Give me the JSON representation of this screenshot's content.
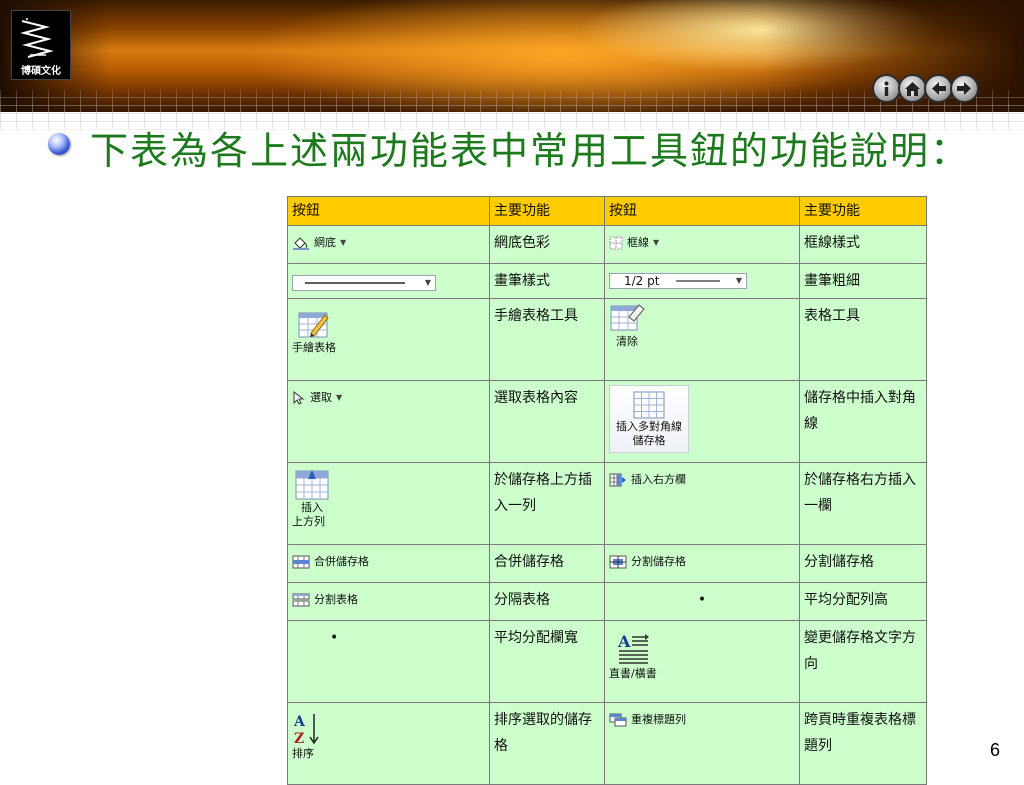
{
  "logo": {
    "text": "博碩文化"
  },
  "nav": [
    "info",
    "home",
    "back",
    "forward"
  ],
  "heading": {
    "text": "下表為各上述兩功能表中常用工具鈕的功能說明："
  },
  "table": {
    "headers": [
      "按鈕",
      "主要功能",
      "按鈕",
      "主要功能"
    ],
    "rows": [
      {
        "b1": "網底",
        "f1": "網底色彩",
        "b2": "框線",
        "f2": "框線樣式"
      },
      {
        "b1": "",
        "f1": "畫筆樣式",
        "b2": "1/2 pt",
        "f2": "畫筆粗細"
      },
      {
        "b1": "手繪表格",
        "f1": "手繪表格工具",
        "b2": "清除",
        "f2": "表格工具"
      },
      {
        "b1": "選取",
        "f1": "選取表格內容",
        "b2": "插入多對角線儲存格",
        "f2": "儲存格中插入對角線"
      },
      {
        "b1": "插入上方列",
        "f1": "於儲存格上方插入一列",
        "b2": "插入右方欄",
        "f2": "於儲存格右方插入一欄"
      },
      {
        "b1": "合併儲存格",
        "f1": "合併儲存格",
        "b2": "分割儲存格",
        "f2": "分割儲存格"
      },
      {
        "b1": "分割表格",
        "f1": "分隔表格",
        "b2": "•",
        "f2": "平均分配列高"
      },
      {
        "b1": "•",
        "f1": "平均分配欄寬",
        "b2": "直書/橫書",
        "f2": "變更儲存格文字方向"
      },
      {
        "b1": "排序",
        "f1": "排序選取的儲存格",
        "b2": "重複標題列",
        "f2": "跨頁時重複表格標題列"
      }
    ],
    "labels": {
      "insert_row_line1": "插入",
      "insert_row_line2": "上方列",
      "diag_line1": "插入多對角線",
      "diag_line2": "儲存格"
    }
  },
  "page_number": "6"
}
